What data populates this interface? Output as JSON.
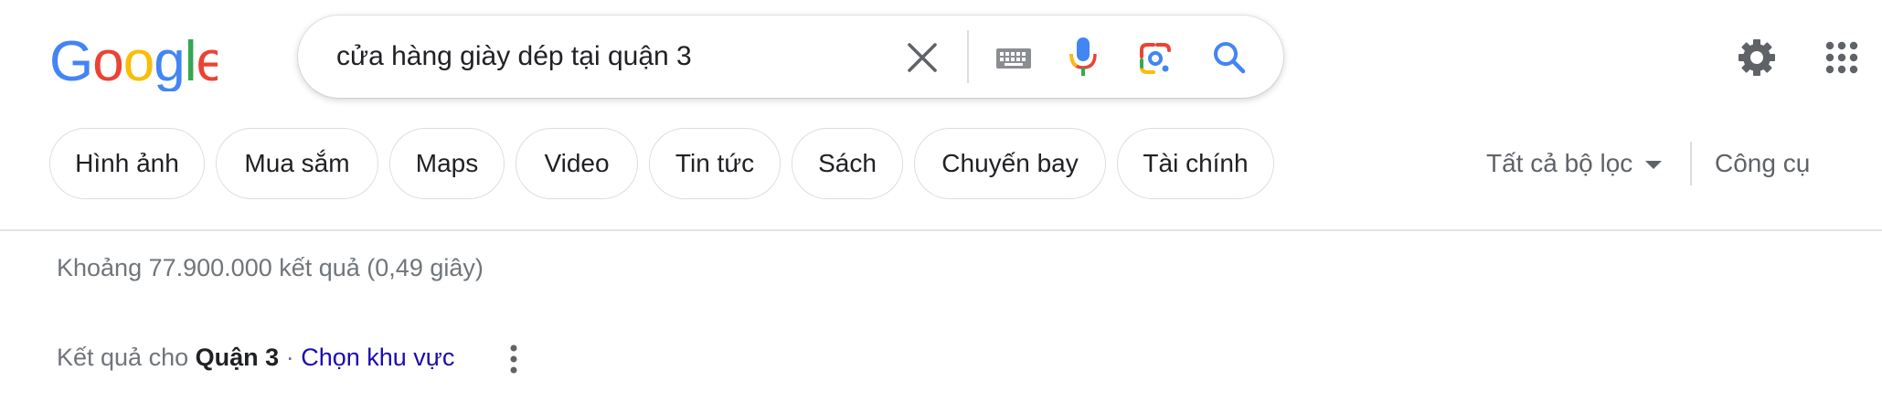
{
  "logo": {
    "text": "Google"
  },
  "search": {
    "query": "cửa hàng giày dép tại quận 3"
  },
  "search_icons": [
    "clear-icon",
    "keyboard-icon",
    "microphone-icon",
    "lens-icon",
    "search-icon"
  ],
  "header_icons": [
    "settings-icon",
    "apps-grid-icon"
  ],
  "chips": [
    "Hình ảnh",
    "Mua sắm",
    "Maps",
    "Video",
    "Tin tức",
    "Sách",
    "Chuyến bay",
    "Tài chính"
  ],
  "filters": {
    "all_filters": "Tất cả bộ lọc",
    "tools": "Công cụ"
  },
  "results": {
    "stats": "Khoảng 77.900.000 kết quả (0,49 giây)",
    "location_prefix": "Kết quả cho",
    "location_name": "Quận 3",
    "separator": "·",
    "choose_area": "Chọn khu vực"
  },
  "colors": {
    "google_blue": "#4285F4",
    "google_red": "#EA4335",
    "google_yellow": "#FBBC05",
    "google_green": "#34A853",
    "link": "#1a0dab",
    "secondary_text": "#70757a"
  }
}
